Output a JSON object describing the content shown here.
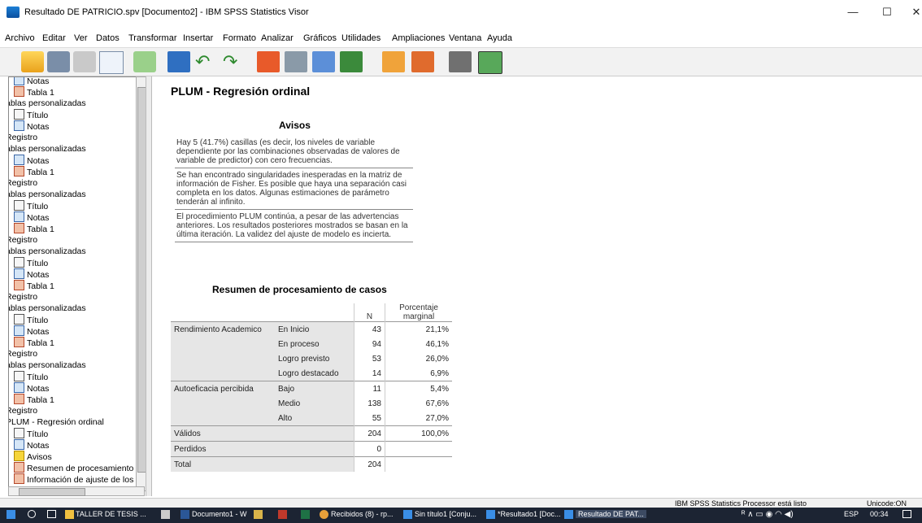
{
  "window": {
    "title": "Resultado DE PATRICIO.spv [Documento2] - IBM SPSS Statistics Visor",
    "min": "—",
    "max": "☐",
    "close": "✕"
  },
  "menu": [
    "Archivo",
    "Editar",
    "Ver",
    "Datos",
    "Transformar",
    "Insertar",
    "Formato",
    "Analizar",
    "Gráficos",
    "Utilidades",
    "Ampliaciones",
    "Ventana",
    "Ayuda"
  ],
  "tree": [
    {
      "icon": "notes",
      "label": "Notas"
    },
    {
      "icon": "table",
      "label": "Tabla 1"
    },
    {
      "icon": "none",
      "label": "ablas personalizadas"
    },
    {
      "icon": "title",
      "label": "Título"
    },
    {
      "icon": "notes",
      "label": "Notas"
    },
    {
      "icon": "none",
      "label": "Registro"
    },
    {
      "icon": "none",
      "label": "ablas personalizadas"
    },
    {
      "icon": "notes",
      "label": "Notas"
    },
    {
      "icon": "table",
      "label": "Tabla 1"
    },
    {
      "icon": "none",
      "label": "Registro"
    },
    {
      "icon": "none",
      "label": "ablas personalizadas"
    },
    {
      "icon": "title",
      "label": "Título"
    },
    {
      "icon": "notes",
      "label": "Notas"
    },
    {
      "icon": "table",
      "label": "Tabla 1"
    },
    {
      "icon": "none",
      "label": "Registro"
    },
    {
      "icon": "none",
      "label": "ablas personalizadas"
    },
    {
      "icon": "title",
      "label": "Título"
    },
    {
      "icon": "notes",
      "label": "Notas"
    },
    {
      "icon": "table",
      "label": "Tabla 1"
    },
    {
      "icon": "none",
      "label": "Registro"
    },
    {
      "icon": "none",
      "label": "ablas personalizadas"
    },
    {
      "icon": "title",
      "label": "Título"
    },
    {
      "icon": "notes",
      "label": "Notas"
    },
    {
      "icon": "table",
      "label": "Tabla 1"
    },
    {
      "icon": "none",
      "label": "Registro"
    },
    {
      "icon": "none",
      "label": "ablas personalizadas"
    },
    {
      "icon": "title",
      "label": "Título"
    },
    {
      "icon": "notes",
      "label": "Notas"
    },
    {
      "icon": "table",
      "label": "Tabla 1"
    },
    {
      "icon": "none",
      "label": "Registro"
    },
    {
      "icon": "none",
      "label": "PLUM - Regresión ordinal"
    },
    {
      "icon": "title",
      "label": "Título"
    },
    {
      "icon": "notes",
      "label": "Notas"
    },
    {
      "icon": "warn",
      "label": "Avisos"
    },
    {
      "icon": "table",
      "label": "Resumen de procesamiento"
    },
    {
      "icon": "table",
      "label": "Información de ajuste de los"
    }
  ],
  "output": {
    "heading": "PLUM - Regresión ordinal",
    "avisos_title": "Avisos",
    "avisos": [
      "Hay 5 (41.7%) casillas (es decir, los niveles de variable dependiente por las combinaciones observadas de valores de variable de predictor) con cero frecuencias.",
      "Se han encontrado singularidades inesperadas en la matriz de información de Fisher. Es posible que haya una separación casi completa en los datos. Algunas estimaciones de parámetro tenderán al infinito.",
      "El procedimiento PLUM continúa, a pesar de las advertencias anteriores. Los resultados posteriores mostrados se basan en la última iteración. La validez del ajuste de modelo es incierta."
    ],
    "table_title": "Resumen de procesamiento de casos",
    "col_n": "N",
    "col_pct": "Porcentaje marginal",
    "rows": [
      {
        "group": "Rendimiento Academico",
        "cat": "En Inicio",
        "n": "43",
        "pct": "21,1%"
      },
      {
        "group": "",
        "cat": "En proceso",
        "n": "94",
        "pct": "46,1%"
      },
      {
        "group": "",
        "cat": "Logro previsto",
        "n": "53",
        "pct": "26,0%"
      },
      {
        "group": "",
        "cat": "Logro destacado",
        "n": "14",
        "pct": "6,9%"
      },
      {
        "group": "Autoeficacia percibida",
        "cat": "Bajo",
        "n": "11",
        "pct": "5,4%"
      },
      {
        "group": "",
        "cat": "Medio",
        "n": "138",
        "pct": "67,6%"
      },
      {
        "group": "",
        "cat": "Alto",
        "n": "55",
        "pct": "27,0%"
      },
      {
        "group": "Válidos",
        "cat": "",
        "n": "204",
        "pct": "100,0%"
      },
      {
        "group": "Perdidos",
        "cat": "",
        "n": "0",
        "pct": ""
      },
      {
        "group": "Total",
        "cat": "",
        "n": "204",
        "pct": ""
      }
    ]
  },
  "status": {
    "processor": "IBM SPSS Statistics Processor está listo",
    "unicode": "Unicode:ON"
  },
  "taskbar": [
    "TALLER DE TESIS ...",
    "Documento1 - W",
    "Recibidos (8) - rp...",
    "Sin título1 [Conju...",
    "*Resultado1 [Doc...",
    "Resultado DE PAT..."
  ],
  "tray": {
    "lang": "ESP",
    "time": "00:34"
  }
}
